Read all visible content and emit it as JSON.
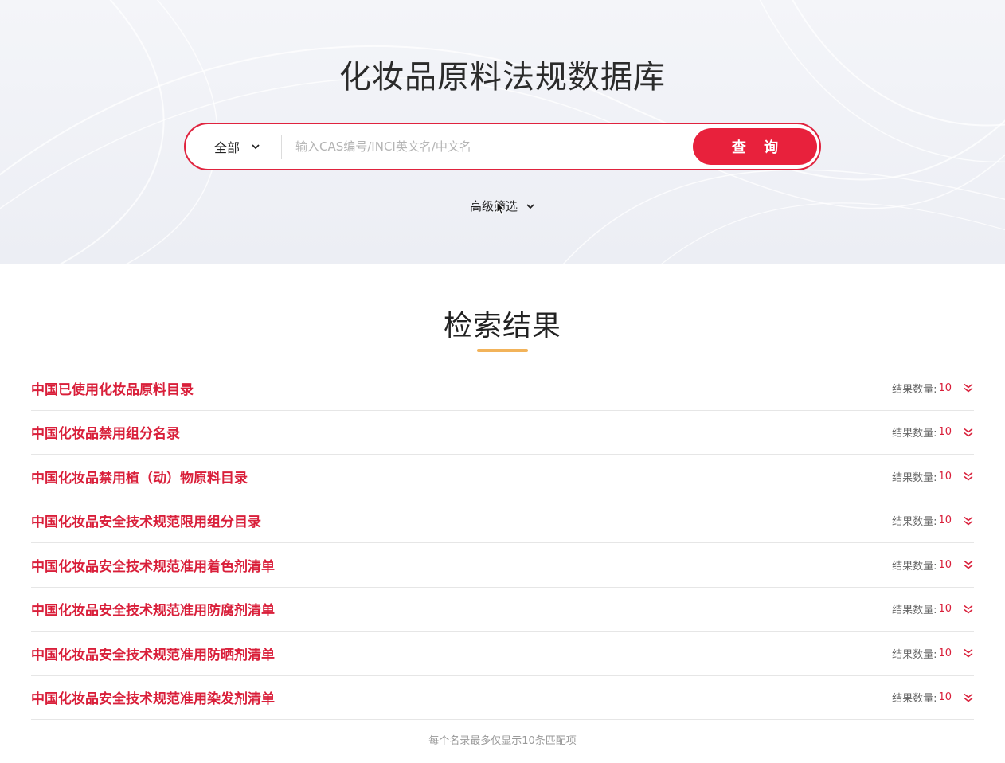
{
  "hero": {
    "title": "化妆品原料法规数据库",
    "scope_label": "全部",
    "search_placeholder": "输入CAS编号/INCI英文名/中文名",
    "search_value": "",
    "query_button": "查 询",
    "advanced_filter": "高级筛选"
  },
  "results": {
    "title": "检索结果",
    "count_label": "结果数量:",
    "items": [
      {
        "name": "中国已使用化妆品原料目录",
        "count": "10"
      },
      {
        "name": "中国化妆品禁用组分名录",
        "count": "10"
      },
      {
        "name": "中国化妆品禁用植（动）物原料目录",
        "count": "10"
      },
      {
        "name": "中国化妆品安全技术规范限用组分目录",
        "count": "10"
      },
      {
        "name": "中国化妆品安全技术规范准用着色剂清单",
        "count": "10"
      },
      {
        "name": "中国化妆品安全技术规范准用防腐剂清单",
        "count": "10"
      },
      {
        "name": "中国化妆品安全技术规范准用防晒剂清单",
        "count": "10"
      },
      {
        "name": "中国化妆品安全技术规范准用染发剂清单",
        "count": "10"
      }
    ],
    "footnote": "每个名录最多仅显示10条匹配项"
  },
  "colors": {
    "accent": "#e8213c",
    "link": "#d91f3a",
    "underline": "#f2b35a"
  },
  "icons": [
    "chevron-down-icon",
    "double-chevron-down-icon",
    "mouse-cursor-icon"
  ]
}
